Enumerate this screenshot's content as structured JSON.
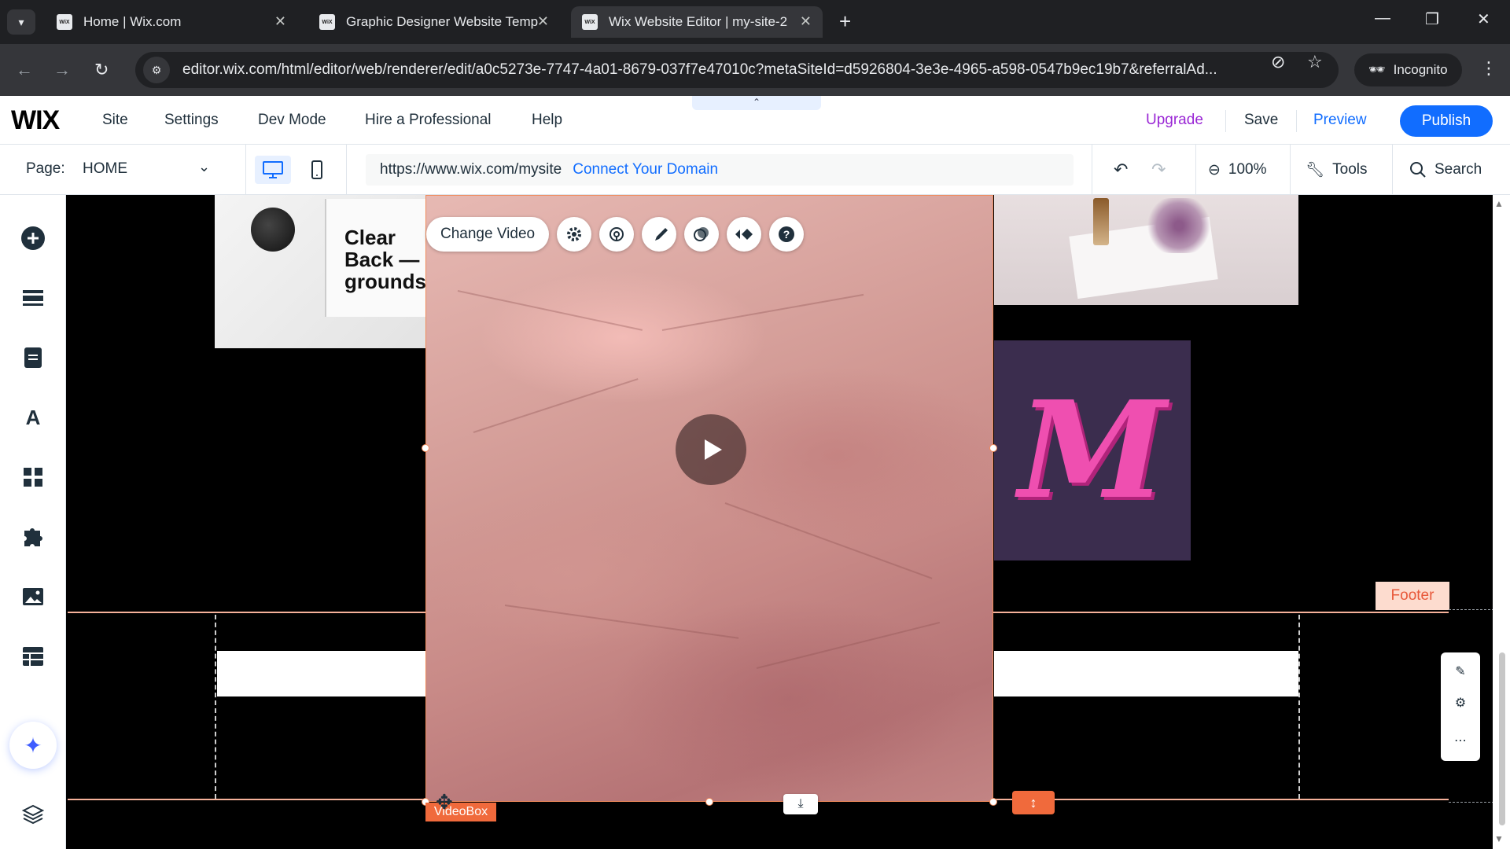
{
  "browser": {
    "tabs": [
      {
        "label": "Home | Wix.com",
        "favicon": "WiX"
      },
      {
        "label": "Graphic Designer Website Temp",
        "favicon": "WiX"
      },
      {
        "label": "Wix Website Editor | my-site-2",
        "favicon": "WiX"
      }
    ],
    "url": "editor.wix.com/html/editor/web/renderer/edit/a0c5273e-7747-4a01-8679-037f7e47010c?metaSiteId=d5926804-3e3e-4965-a598-0547b9ec19b7&referralAd...",
    "incognito_label": "Incognito"
  },
  "wix_header": {
    "logo": "WIX",
    "menu": [
      "Site",
      "Settings",
      "Dev Mode",
      "Hire a Professional",
      "Help"
    ],
    "upgrade": "Upgrade",
    "save": "Save",
    "preview": "Preview",
    "publish": "Publish"
  },
  "page_bar": {
    "page_label": "Page:",
    "page_name": "HOME",
    "site_url": "https://www.wix.com/mysite",
    "connect_domain": "Connect Your Domain",
    "zoom": "100%",
    "tools": "Tools",
    "search": "Search"
  },
  "canvas": {
    "book_text": "Clear\nBack —\ngrounds",
    "footer_tag": "Footer",
    "video_toolbar": {
      "change_video": "Change Video"
    },
    "videobox_label": "VideoBox"
  },
  "colors": {
    "accent": "#116dff",
    "upgrade": "#9a27d5",
    "selection": "#f06a3c",
    "footer_tag_bg": "#fddccf"
  }
}
